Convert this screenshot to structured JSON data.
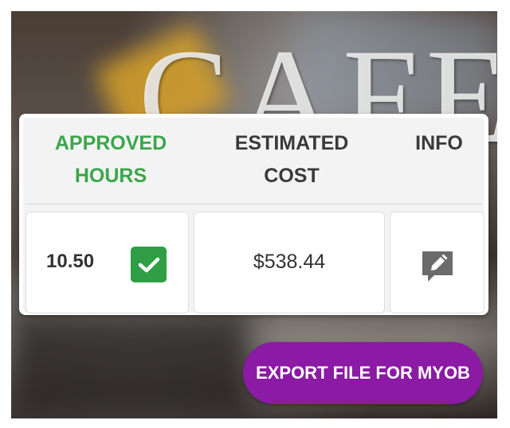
{
  "table": {
    "headers": {
      "approved_line1": "APPROVED",
      "approved_line2": "HOURS",
      "estimated_line1": "ESTIMATED",
      "estimated_line2": "COST",
      "info": "INFO"
    },
    "row": {
      "approved_hours": "10.50",
      "approved": true,
      "estimated_cost": "$538.44"
    }
  },
  "background_sign_text": "CAFE",
  "export_button_label": "EXPORT FILE FOR MYOB",
  "icons": {
    "approved": "checkmark-icon",
    "info": "edit-comment-icon"
  },
  "colors": {
    "approved_header": "#3aa64a",
    "check_button": "#2f9e44",
    "export_button": "#8b1aa5",
    "edit_icon": "#6b6b6b"
  }
}
